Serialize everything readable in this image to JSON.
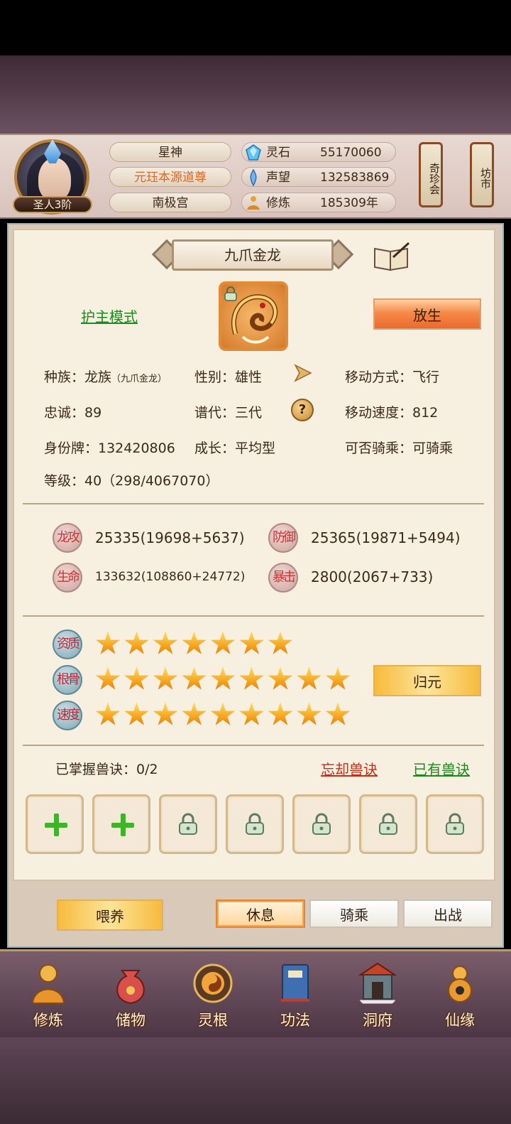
{
  "header": {
    "rank_badge": "圣人3阶",
    "title_1": "星神",
    "title_2": "元珏本源道尊",
    "title_3": "南极宫",
    "resources": [
      {
        "label": "灵石",
        "value": "55170060",
        "icon": "spirit-stone-icon"
      },
      {
        "label": "声望",
        "value": "132583869",
        "icon": "prestige-icon"
      },
      {
        "label": "修炼",
        "value": "185309年",
        "icon": "cultivation-icon"
      }
    ],
    "side_buttons": {
      "treasure_fair": "奇珍会",
      "market": "坊市"
    }
  },
  "pet": {
    "name": "九爪金龙",
    "guard_mode": "护主模式",
    "release_label": "放生",
    "info": {
      "race": "种族：龙族",
      "race_sub": "（九爪金龙）",
      "gender": "性别：雄性",
      "move_mode": "移动方式：飞行",
      "loyalty": "忠诚：89",
      "generation": "谱代：三代",
      "move_speed": "移动速度：812",
      "id_tag": "身份牌：132420806",
      "growth": "成长：平均型",
      "rideable": "可否骑乘：可骑乘",
      "level": "等级：40（298/4067070）"
    },
    "stats": [
      {
        "badge": "龙攻",
        "value": "25335(19698+5637)"
      },
      {
        "badge": "防御",
        "value": "25365(19871+5494)"
      },
      {
        "badge": "生命",
        "value": "133632(108860+24772)"
      },
      {
        "badge": "暴击",
        "value": "2800(2067+733)"
      }
    ],
    "qualities": [
      {
        "badge": "资质",
        "stars": 7
      },
      {
        "badge": "根骨",
        "stars": 9
      },
      {
        "badge": "速度",
        "stars": 9
      }
    ],
    "return_label": "归元",
    "skills": {
      "mastered": "已掌握兽诀：0/2",
      "forget": "忘却兽诀",
      "owned": "已有兽诀"
    }
  },
  "actions": {
    "feed": "喂养",
    "rest": "休息",
    "ride": "骑乘",
    "battle": "出战"
  },
  "nav": [
    {
      "label": "修炼",
      "icon": "cultivate-icon"
    },
    {
      "label": "储物",
      "icon": "storage-bag-icon"
    },
    {
      "label": "灵根",
      "icon": "spirit-root-icon"
    },
    {
      "label": "功法",
      "icon": "technique-book-icon"
    },
    {
      "label": "洞府",
      "icon": "cave-dwelling-icon"
    },
    {
      "label": "仙缘",
      "icon": "fate-gourd-icon"
    }
  ]
}
